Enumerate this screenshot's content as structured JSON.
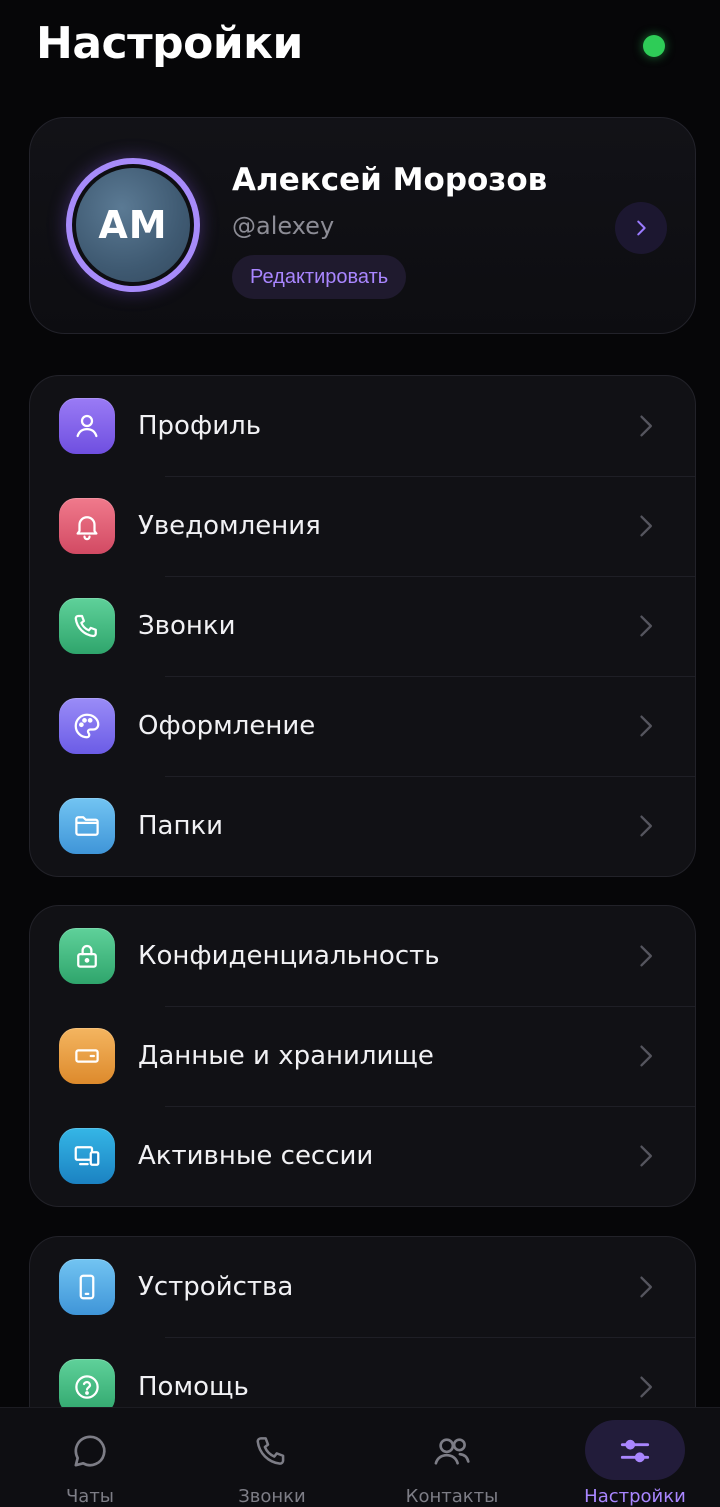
{
  "header": {
    "title": "Настройки"
  },
  "profile": {
    "initials": "АМ",
    "name": "Алексей Морозов",
    "username": "@alexey",
    "edit_label": "Редактировать"
  },
  "groups": [
    {
      "items": [
        {
          "label": "Профиль",
          "icon": "user-icon",
          "color": "#7c5cf0"
        },
        {
          "label": "Уведомления",
          "icon": "bell-icon",
          "color": "#e05a72"
        },
        {
          "label": "Звонки",
          "icon": "phone-icon",
          "color": "#3dbb7f"
        },
        {
          "label": "Оформление",
          "icon": "palette-icon",
          "color": "#7a6bee"
        },
        {
          "label": "Папки",
          "icon": "folder-icon",
          "color": "#52a9e6"
        }
      ]
    },
    {
      "items": [
        {
          "label": "Конфиденциальность",
          "icon": "lock-icon",
          "color": "#3dbb7f"
        },
        {
          "label": "Данные и хранилище",
          "icon": "storage-icon",
          "color": "#e99b3f"
        },
        {
          "label": "Активные сессии",
          "icon": "devices-icon",
          "color": "#239ad3"
        }
      ]
    },
    {
      "items": [
        {
          "label": "Устройства",
          "icon": "smartphone-icon",
          "color": "#52a9e6"
        },
        {
          "label": "Помощь",
          "icon": "help-icon",
          "color": "#3dbb7f"
        }
      ]
    }
  ],
  "tabbar": {
    "tabs": [
      {
        "label": "Чаты",
        "icon": "chat-icon",
        "active": false
      },
      {
        "label": "Звонки",
        "icon": "phone-icon",
        "active": false
      },
      {
        "label": "Контакты",
        "icon": "contacts-icon",
        "active": false
      },
      {
        "label": "Настройки",
        "icon": "sliders-icon",
        "active": true
      }
    ]
  },
  "colors": {
    "accent": "#a986ff",
    "online": "#2ecc57",
    "background": "#060608"
  }
}
